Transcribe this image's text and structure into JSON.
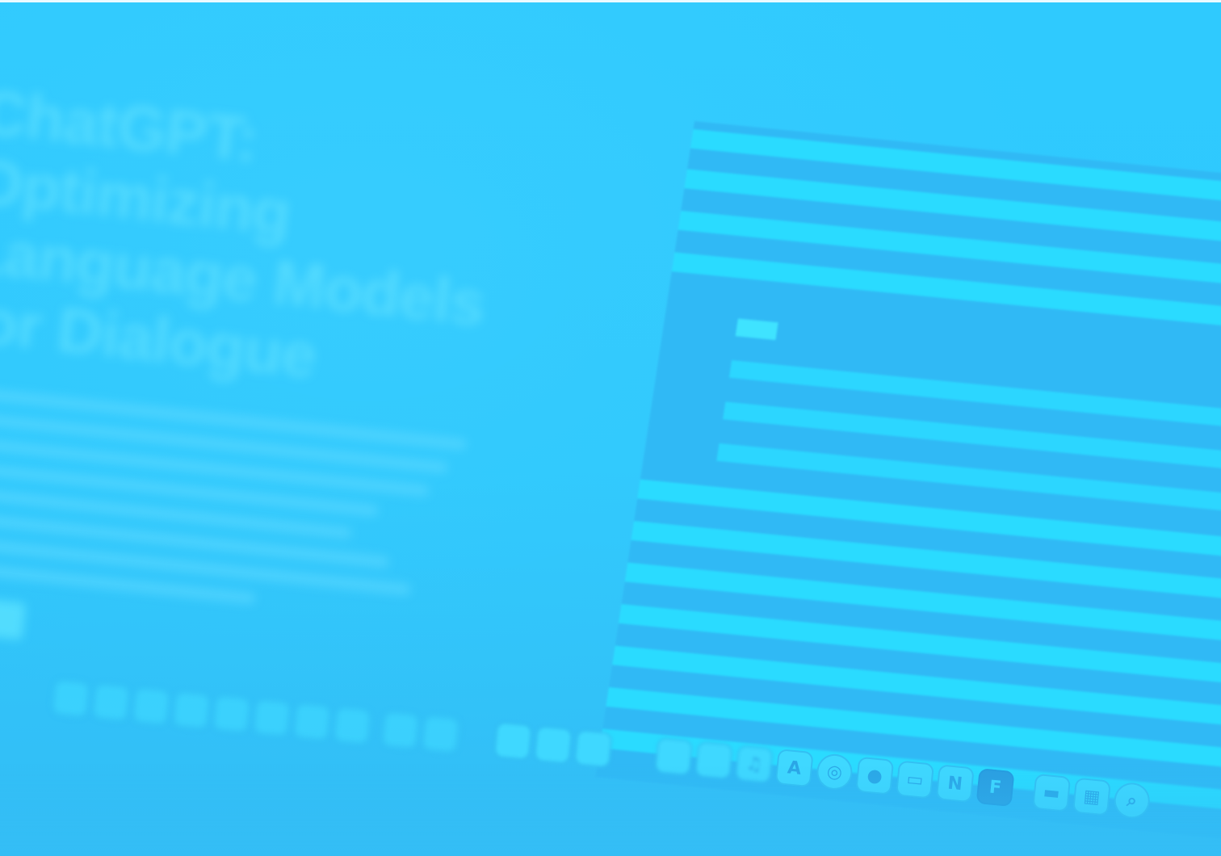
{
  "article": {
    "title_lines": [
      "ChatGPT: Optimizing",
      "Language Models",
      "for Dialogue"
    ]
  },
  "dock": {
    "icons": [
      "app-icon",
      "app-icon",
      "app-icon",
      "app-icon",
      "app-icon",
      "app-icon",
      "app-icon",
      "app-icon",
      "app-icon",
      "app-icon",
      "app-icon",
      "app-icon",
      "app-icon",
      "app-icon",
      "app-icon",
      "music-icon",
      "acrobat-icon",
      "safari-icon",
      "chrome-icon",
      "terminal-icon",
      "notion-icon",
      "figma-icon",
      "app-icon",
      "calculator-icon",
      "search-icon"
    ]
  },
  "colors": {
    "background": "#2ec8fd",
    "stripe": "#2adbff",
    "panel": "#30b9f5"
  }
}
